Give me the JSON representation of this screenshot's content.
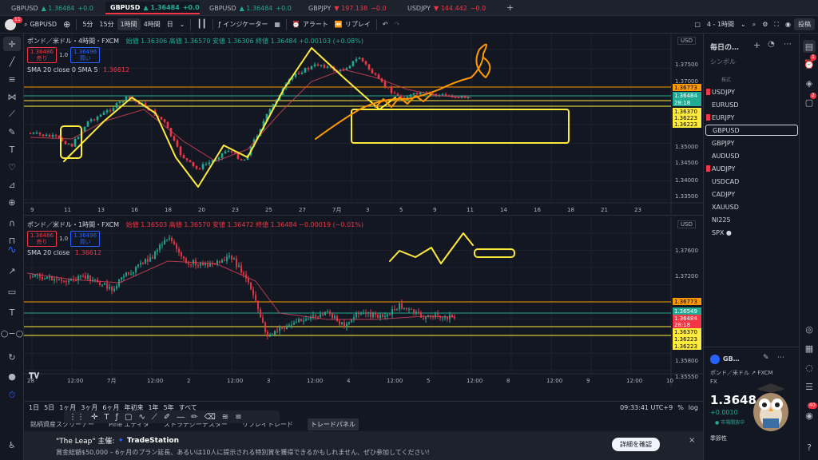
{
  "tabs": [
    {
      "symbol": "GBPUSD",
      "price": "▲ 1.36484",
      "change": "+0.0",
      "dir": "up",
      "active": false
    },
    {
      "symbol": "GBPUSD",
      "price": "▲ 1.36484",
      "change": "+0.0",
      "dir": "up",
      "active": true
    },
    {
      "symbol": "GBPUSD",
      "price": "▲ 1.36484",
      "change": "+0.0",
      "dir": "up",
      "active": false
    },
    {
      "symbol": "GBPJPY",
      "price": "▼ 197.138",
      "change": "−0.0",
      "dir": "dn",
      "active": false
    },
    {
      "symbol": "USDJPY",
      "price": "▼ 144.442",
      "change": "−0.0",
      "dir": "dn",
      "active": false
    }
  ],
  "toolbar": {
    "badge": "11",
    "symbol": "GBPUSD",
    "intervals": [
      "5分",
      "15分",
      "1時間",
      "4時間",
      "日"
    ],
    "selected_interval": "1時間",
    "indicators": "インジケーター",
    "alert": "アラート",
    "replay": "リプレイ",
    "layout": "4 - 1時間",
    "publish": "投稿"
  },
  "top_chart": {
    "title": "ポンド／米ドル・4時間・FXCM",
    "ohlc": "始値 1.36306 高値 1.36570 安値 1.36306 終値 1.36484 +0.00103 (+0.08%)",
    "sell_price": "1.36486",
    "sell_label": "売り",
    "spread": "1.0",
    "buy_price": "1.36496",
    "buy_label": "買い",
    "indicator": "SMA 20 close 0 SMA 5",
    "indicator_value": "1.36612",
    "currency": "USD",
    "y_ticks": [
      "1.37500",
      "1.37000",
      "1.35000",
      "1.34500",
      "1.34000",
      "1.33500"
    ],
    "price_labels": [
      {
        "text": "1.36773",
        "color": "#ff9800"
      },
      {
        "text": "1.36484",
        "color": "#22ab94"
      },
      {
        "text": "28:18",
        "color": "#22ab94"
      },
      {
        "text": "1.36370",
        "color": "#ffeb3b"
      },
      {
        "text": "1.36223",
        "color": "#ffeb3b"
      },
      {
        "text": "1.36223",
        "color": "#ffeb3b"
      }
    ],
    "x_ticks": [
      "9",
      "11",
      "13",
      "16",
      "18",
      "20",
      "23",
      "25",
      "27",
      "7月",
      "3",
      "5",
      "9",
      "11",
      "14",
      "16",
      "18",
      "21",
      "23"
    ]
  },
  "bottom_chart": {
    "title": "ポンド／米ドル・1時間・FXCM",
    "ohlc": "始値 1.36503 高値 1.36570 安値 1.36472 終値 1.36484 −0.00019 (−0.01%)",
    "sell_price": "1.36486",
    "sell_label": "売り",
    "spread": "1.0",
    "buy_price": "1.36496",
    "buy_label": "買い",
    "indicator": "SMA 20 close",
    "indicator_value": "1.36612",
    "currency": "USD",
    "y_ticks": [
      "1.37600",
      "1.37200",
      "1.35800",
      "1.35550"
    ],
    "price_labels": [
      {
        "text": "1.36773",
        "color": "#ff9800"
      },
      {
        "text": "1.36549",
        "color": "#22ab94"
      },
      {
        "text": "1.36484",
        "color": "#f23645"
      },
      {
        "text": "28:18",
        "color": "#f23645"
      },
      {
        "text": "1.36370",
        "color": "#ffeb3b"
      },
      {
        "text": "1.36223",
        "color": "#ffeb3b"
      },
      {
        "text": "1.36223",
        "color": "#ffeb3b"
      }
    ],
    "x_ticks": [
      "28",
      "12:00",
      "7月",
      "12:00",
      "2",
      "12:00",
      "3",
      "12:00",
      "4",
      "12:00",
      "5",
      "12:00",
      "8",
      "12:00",
      "9",
      "12:00",
      "10"
    ]
  },
  "bottombar": {
    "ranges": [
      "1日",
      "5日",
      "1ヶ月",
      "3ヶ月",
      "6ヶ月",
      "年初来",
      "1年",
      "5年",
      "すべて"
    ],
    "time": "09:33:41 UTC+9",
    "percent": "%",
    "log": "log"
  },
  "panels": [
    "銘柄資産スクリーナー",
    "Pine エディタ",
    "ストラテジーテスター",
    "リプレイトレード",
    "トレードパネル"
  ],
  "ad": {
    "title": "\"The Leap\" 主催:",
    "brand": "TradeStation",
    "body": "賞金総額$50,000 – 6ヶ月のプラン延長、あるいは10人に提示される特別賞を獲得できるかもしれません、ぜひ参加してください!",
    "cta": "詳細を確認"
  },
  "watchlist": {
    "title": "毎日の…",
    "symbol_header": "シンボル",
    "section": "株式",
    "items": [
      {
        "name": "USDJPY",
        "flag": true
      },
      {
        "name": "EURUSD",
        "flag": false
      },
      {
        "name": "EURJPY",
        "flag": true
      },
      {
        "name": "GBPUSD",
        "flag": false,
        "selected": true
      },
      {
        "name": "GBPJPY",
        "flag": false
      },
      {
        "name": "AUDUSD",
        "flag": false
      },
      {
        "name": "AUDJPY",
        "flag": true
      },
      {
        "name": "USDCAD",
        "flag": false
      },
      {
        "name": "CADJPY",
        "flag": false
      },
      {
        "name": "XAUUSD",
        "flag": false
      },
      {
        "name": "NI225",
        "flag": false
      },
      {
        "name": "SPX ●",
        "flag": false
      }
    ]
  },
  "detail": {
    "symbol": "GB…",
    "name": "ポンド／米ドル",
    "exchange": "FXCM",
    "type": "FX",
    "price": "1.3648",
    "change": "+0.0010",
    "status": "● 市場開放中",
    "season": "季節性"
  },
  "rightbar_badges": [
    "1",
    "2",
    "40"
  ],
  "colors": {
    "up": "#22ab94",
    "down": "#f23645",
    "yellow": "#ffeb3b",
    "orange": "#ff9800"
  }
}
